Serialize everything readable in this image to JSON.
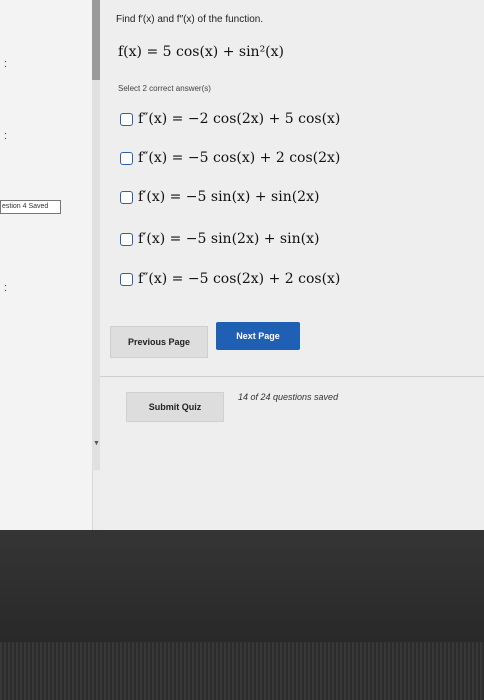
{
  "sidebar": {
    "mark_top": ":",
    "mark_mid": ":",
    "saved_text": "estion 4 Saved",
    "mark_bottom": ":"
  },
  "question": {
    "title": "Find f′(x) and f″(x) of the function.",
    "function": "f(x) = 5 cos(x) + sin²(x)",
    "instruction": "Select 2 correct answer(s)"
  },
  "options": [
    {
      "label": "f″(x) = −2 cos(2x) + 5 cos(x)",
      "checked": false
    },
    {
      "label": "f″(x) = −5 cos(x) + 2 cos(2x)",
      "checked": false
    },
    {
      "label": "f′(x) = −5 sin(x) + sin(2x)",
      "checked": false
    },
    {
      "label": "f′(x) = −5 sin(2x) + sin(x)",
      "checked": false
    },
    {
      "label": "f″(x) = −5 cos(2x) + 2 cos(x)",
      "checked": false
    }
  ],
  "nav": {
    "previous_label": "Previous Page",
    "next_label": "Next Page",
    "submit_label": "Submit Quiz",
    "save_status": "14 of 24 questions saved"
  },
  "colors": {
    "accent": "#1f5fb4",
    "checkbox_border": "#2f5fa7"
  }
}
